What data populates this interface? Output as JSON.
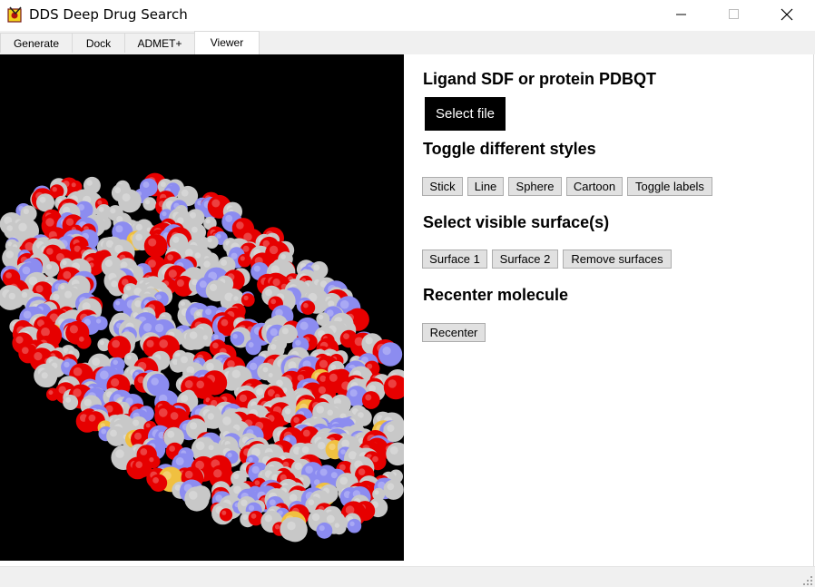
{
  "window": {
    "title": "DDS Deep Drug Search",
    "icon": "dds-app-icon",
    "controls": [
      "minimize-icon",
      "maximize-icon",
      "close-icon"
    ]
  },
  "tabs": [
    {
      "label": "Generate",
      "active": false
    },
    {
      "label": "Dock",
      "active": false
    },
    {
      "label": "ADMET+",
      "active": false
    },
    {
      "label": "Viewer",
      "active": true
    }
  ],
  "viewer": {
    "description_icon": "protein-surface-render",
    "colors": {
      "background": "#000000",
      "carbon": "#c8c8c8",
      "oxygen": "#e60000",
      "nitrogen": "#8c8cf0",
      "sulfur": "#f0c040"
    }
  },
  "panel": {
    "file_heading": "Ligand SDF or protein PDBQT",
    "select_file_label": "Select file",
    "styles_heading": "Toggle different styles",
    "style_buttons": [
      "Stick",
      "Line",
      "Sphere",
      "Cartoon",
      "Toggle labels"
    ],
    "surface_heading": "Select visible surface(s)",
    "surface_buttons": [
      "Surface 1",
      "Surface 2",
      "Remove surfaces"
    ],
    "recenter_heading": "Recenter molecule",
    "recenter_label": "Recenter"
  }
}
